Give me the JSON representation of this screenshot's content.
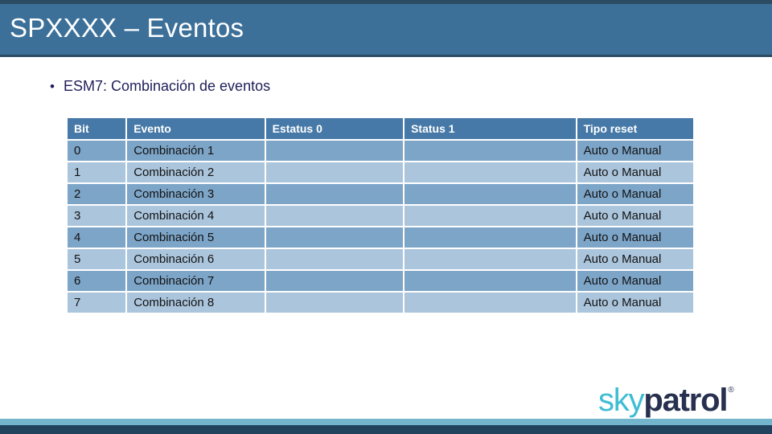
{
  "header": {
    "title": "SPXXXX – Eventos"
  },
  "bullet": {
    "marker": "•",
    "text": "ESM7: Combinación de eventos"
  },
  "table": {
    "columns": [
      "Bit",
      "Evento",
      "Estatus 0",
      "Status 1",
      "Tipo reset"
    ],
    "rows": [
      {
        "bit": "0",
        "evento": "Combinación 1",
        "estatus0": "",
        "status1": "",
        "tipo_reset": "Auto o Manual"
      },
      {
        "bit": "1",
        "evento": "Combinación  2",
        "estatus0": "",
        "status1": "",
        "tipo_reset": "Auto o Manual"
      },
      {
        "bit": "2",
        "evento": "Combinación  3",
        "estatus0": "",
        "status1": "",
        "tipo_reset": "Auto o Manual"
      },
      {
        "bit": "3",
        "evento": "Combinación  4",
        "estatus0": "",
        "status1": "",
        "tipo_reset": "Auto o Manual"
      },
      {
        "bit": "4",
        "evento": "Combinación 5",
        "estatus0": "",
        "status1": "",
        "tipo_reset": "Auto o Manual"
      },
      {
        "bit": "5",
        "evento": "Combinación 6",
        "estatus0": "",
        "status1": "",
        "tipo_reset": "Auto o Manual"
      },
      {
        "bit": "6",
        "evento": "Combinación 7",
        "estatus0": "",
        "status1": "",
        "tipo_reset": "Auto o Manual"
      },
      {
        "bit": "7",
        "evento": "Combinación 8",
        "estatus0": "",
        "status1": "",
        "tipo_reset": "Auto o Manual"
      }
    ]
  },
  "logo": {
    "part_one": "sky",
    "part_two": "patrol",
    "registered_mark": "®"
  },
  "colors": {
    "header_band": "#3C7099",
    "header_rule": "#2C4C64",
    "table_header": "#4679A7",
    "row_dark": "#7DA5C8",
    "row_light": "#ABC5DC",
    "bullet_text": "#1E1E5A",
    "footer_accent": "#74B5CE",
    "footer_dark": "#21425C",
    "logo_sky": "#3FBDD4",
    "logo_patrol": "#27314F"
  }
}
